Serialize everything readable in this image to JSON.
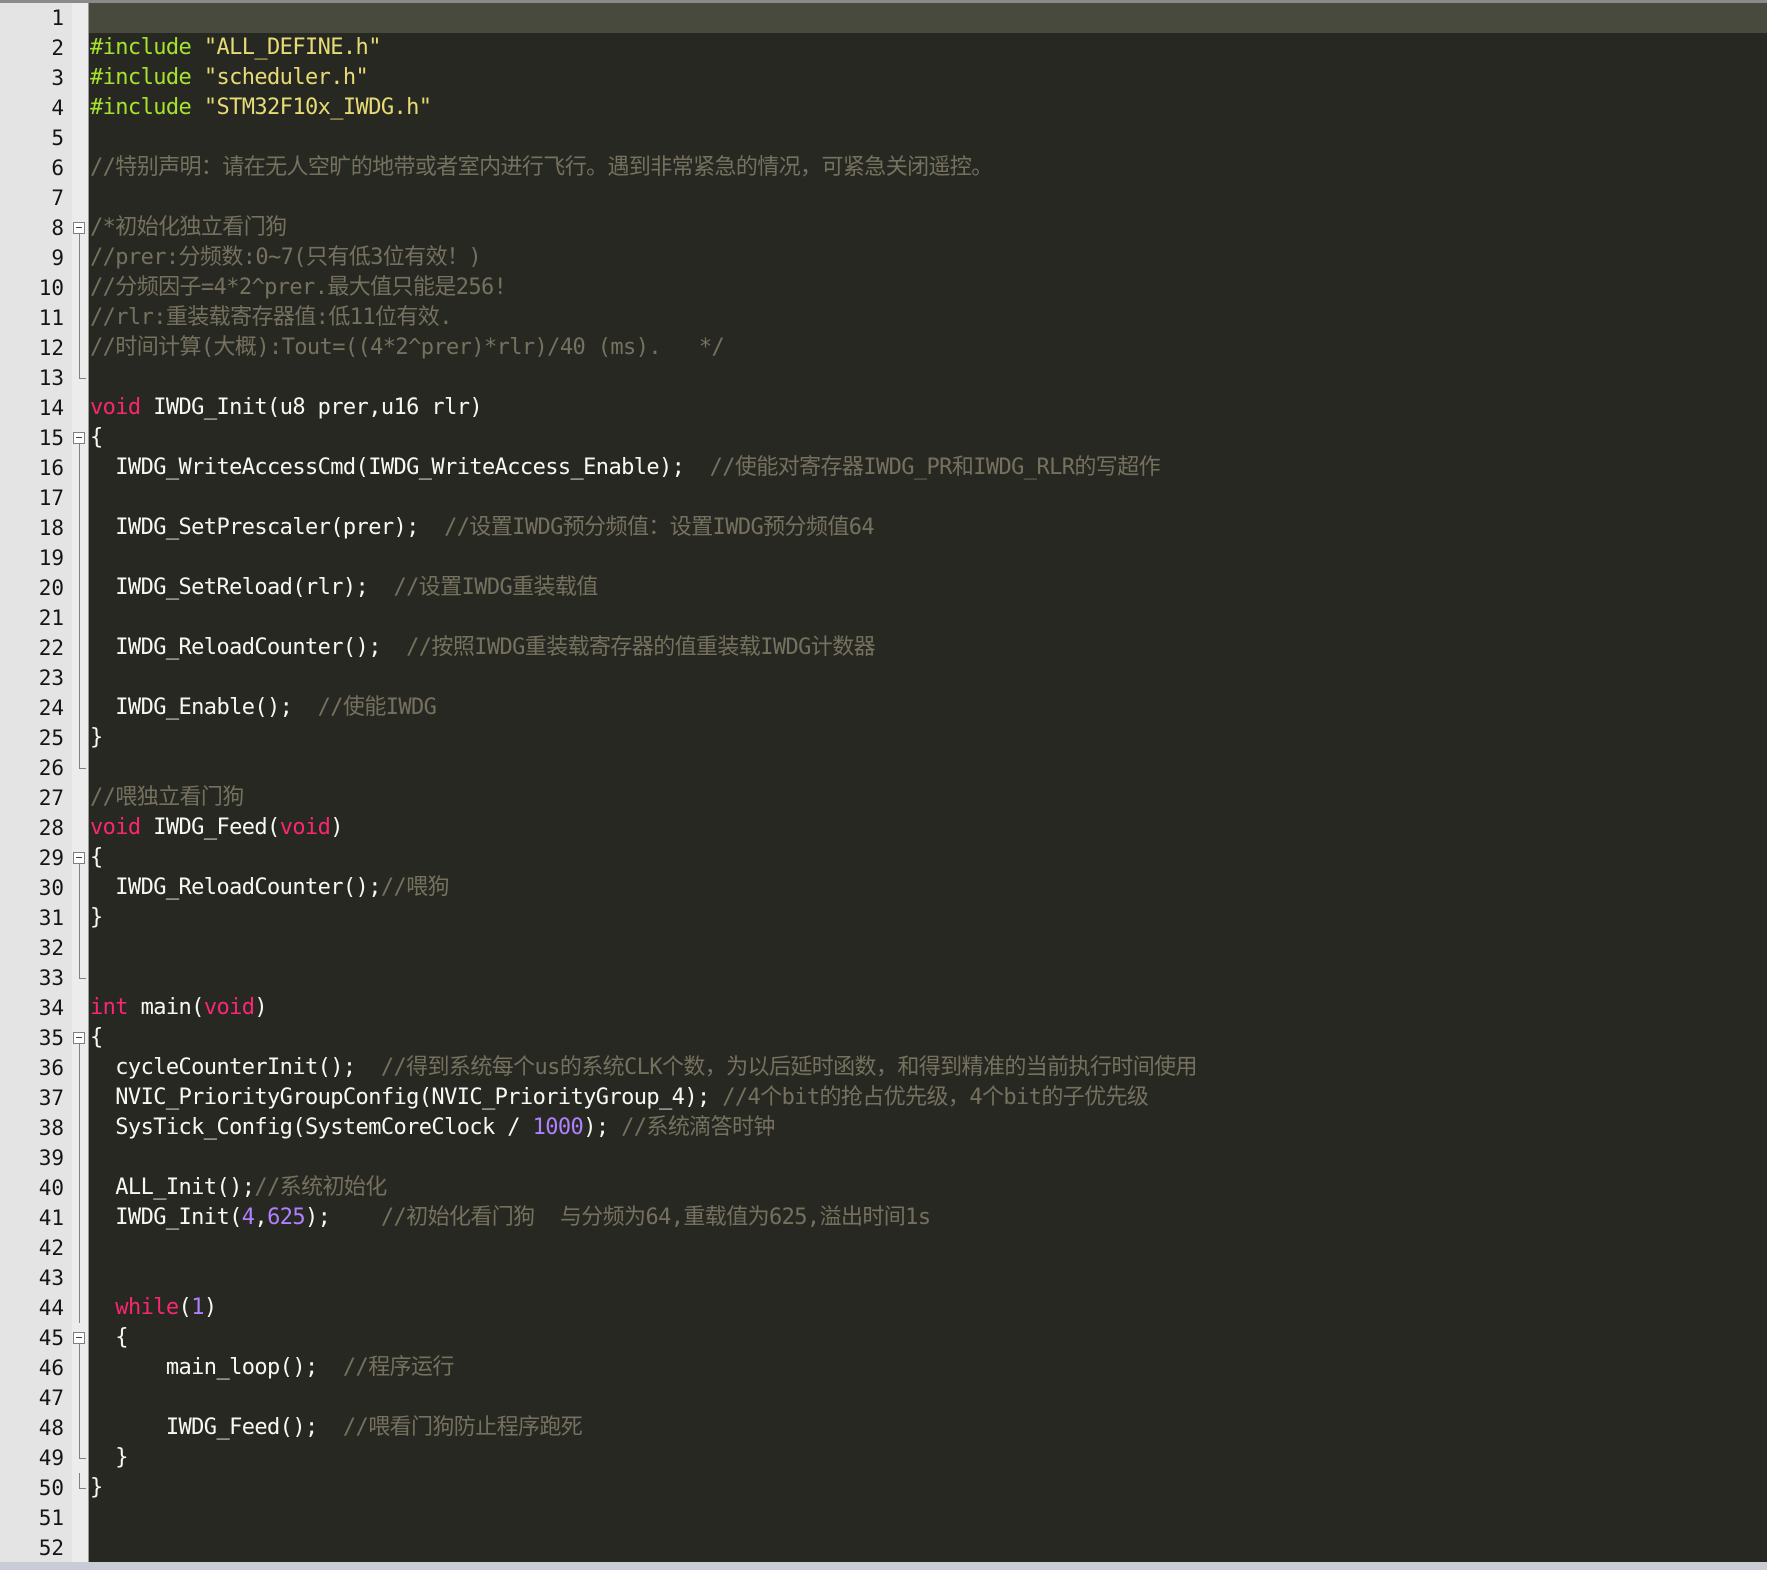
{
  "theme": {
    "background": "#272822",
    "current_line": "#484a3e",
    "gutter_bg": "#e4e4e4",
    "line_number_color": "#141414",
    "token_colors": {
      "pre": "#a6e22e",
      "str": "#e6db74",
      "cmt": "#75715e",
      "kw": "#f92672",
      "num": "#ae81ff",
      "pl": "#f8f8f2"
    }
  },
  "editor": {
    "lines": [
      {
        "n": "1",
        "fold": "",
        "tokens": []
      },
      {
        "n": "2",
        "fold": "",
        "tokens": [
          {
            "t": "pre",
            "v": "#include "
          },
          {
            "t": "str",
            "v": "\"ALL_DEFINE.h\""
          }
        ]
      },
      {
        "n": "3",
        "fold": "",
        "tokens": [
          {
            "t": "pre",
            "v": "#include "
          },
          {
            "t": "str",
            "v": "\"scheduler.h\""
          }
        ]
      },
      {
        "n": "4",
        "fold": "",
        "tokens": [
          {
            "t": "pre",
            "v": "#include "
          },
          {
            "t": "str",
            "v": "\"STM32F10x_IWDG.h\""
          }
        ]
      },
      {
        "n": "5",
        "fold": "",
        "tokens": []
      },
      {
        "n": "6",
        "fold": "",
        "tokens": [
          {
            "t": "cmt",
            "v": "//特别声明：请在无人空旷的地带或者室内进行飞行。遇到非常紧急的情况，可紧急关闭遥控。"
          }
        ]
      },
      {
        "n": "7",
        "fold": "",
        "tokens": []
      },
      {
        "n": "8",
        "fold": "start",
        "tokens": [
          {
            "t": "cmt",
            "v": "/*初始化独立看门狗"
          }
        ]
      },
      {
        "n": "9",
        "fold": "line",
        "tokens": [
          {
            "t": "cmt",
            "v": "//prer:分频数:0~7(只有低3位有效！)"
          }
        ]
      },
      {
        "n": "10",
        "fold": "line",
        "tokens": [
          {
            "t": "cmt",
            "v": "//分频因子=4*2^prer.最大值只能是256!"
          }
        ]
      },
      {
        "n": "11",
        "fold": "line",
        "tokens": [
          {
            "t": "cmt",
            "v": "//rlr:重装载寄存器值:低11位有效."
          }
        ]
      },
      {
        "n": "12",
        "fold": "line",
        "tokens": [
          {
            "t": "cmt",
            "v": "//时间计算(大概):Tout=((4*2^prer)*rlr)/40 (ms).   */"
          }
        ]
      },
      {
        "n": "13",
        "fold": "end",
        "tokens": []
      },
      {
        "n": "14",
        "fold": "",
        "tokens": [
          {
            "t": "kw",
            "v": "void"
          },
          {
            "t": "pl",
            "v": " IWDG_Init(u8 prer,u16 rlr)"
          }
        ]
      },
      {
        "n": "15",
        "fold": "start",
        "tokens": [
          {
            "t": "pl",
            "v": "{"
          }
        ]
      },
      {
        "n": "16",
        "fold": "line",
        "tokens": [
          {
            "t": "pl",
            "v": "  IWDG_WriteAccessCmd(IWDG_WriteAccess_Enable);  "
          },
          {
            "t": "cmt",
            "v": "//使能对寄存器IWDG_PR和IWDG_RLR的写超作"
          }
        ]
      },
      {
        "n": "17",
        "fold": "line",
        "tokens": []
      },
      {
        "n": "18",
        "fold": "line",
        "tokens": [
          {
            "t": "pl",
            "v": "  IWDG_SetPrescaler(prer);  "
          },
          {
            "t": "cmt",
            "v": "//设置IWDG预分频值：设置IWDG预分频值64"
          }
        ]
      },
      {
        "n": "19",
        "fold": "line",
        "tokens": []
      },
      {
        "n": "20",
        "fold": "line",
        "tokens": [
          {
            "t": "pl",
            "v": "  IWDG_SetReload(rlr);  "
          },
          {
            "t": "cmt",
            "v": "//设置IWDG重装载值"
          }
        ]
      },
      {
        "n": "21",
        "fold": "line",
        "tokens": []
      },
      {
        "n": "22",
        "fold": "line",
        "tokens": [
          {
            "t": "pl",
            "v": "  IWDG_ReloadCounter();  "
          },
          {
            "t": "cmt",
            "v": "//按照IWDG重装载寄存器的值重装载IWDG计数器"
          }
        ]
      },
      {
        "n": "23",
        "fold": "line",
        "tokens": []
      },
      {
        "n": "24",
        "fold": "line",
        "tokens": [
          {
            "t": "pl",
            "v": "  IWDG_Enable();  "
          },
          {
            "t": "cmt",
            "v": "//使能IWDG"
          }
        ]
      },
      {
        "n": "25",
        "fold": "line",
        "tokens": [
          {
            "t": "pl",
            "v": "}"
          }
        ]
      },
      {
        "n": "26",
        "fold": "end",
        "tokens": []
      },
      {
        "n": "27",
        "fold": "",
        "tokens": [
          {
            "t": "cmt",
            "v": "//喂独立看门狗"
          }
        ]
      },
      {
        "n": "28",
        "fold": "",
        "tokens": [
          {
            "t": "kw",
            "v": "void"
          },
          {
            "t": "pl",
            "v": " IWDG_Feed("
          },
          {
            "t": "kw",
            "v": "void"
          },
          {
            "t": "pl",
            "v": ")"
          }
        ]
      },
      {
        "n": "29",
        "fold": "start",
        "tokens": [
          {
            "t": "pl",
            "v": "{"
          }
        ]
      },
      {
        "n": "30",
        "fold": "line",
        "tokens": [
          {
            "t": "pl",
            "v": "  IWDG_ReloadCounter();"
          },
          {
            "t": "cmt",
            "v": "//喂狗"
          }
        ]
      },
      {
        "n": "31",
        "fold": "line",
        "tokens": [
          {
            "t": "pl",
            "v": "}"
          }
        ]
      },
      {
        "n": "32",
        "fold": "line",
        "tokens": []
      },
      {
        "n": "33",
        "fold": "end",
        "tokens": []
      },
      {
        "n": "34",
        "fold": "",
        "tokens": [
          {
            "t": "kw",
            "v": "int"
          },
          {
            "t": "pl",
            "v": " main("
          },
          {
            "t": "kw",
            "v": "void"
          },
          {
            "t": "pl",
            "v": ")"
          }
        ]
      },
      {
        "n": "35",
        "fold": "start",
        "tokens": [
          {
            "t": "pl",
            "v": "{"
          }
        ]
      },
      {
        "n": "36",
        "fold": "line",
        "tokens": [
          {
            "t": "pl",
            "v": "  cycleCounterInit();  "
          },
          {
            "t": "cmt",
            "v": "//得到系统每个us的系统CLK个数，为以后延时函数，和得到精准的当前执行时间使用"
          }
        ]
      },
      {
        "n": "37",
        "fold": "line",
        "tokens": [
          {
            "t": "pl",
            "v": "  NVIC_PriorityGroupConfig(NVIC_PriorityGroup_4); "
          },
          {
            "t": "cmt",
            "v": "//4个bit的抢占优先级，4个bit的子优先级"
          }
        ]
      },
      {
        "n": "38",
        "fold": "line",
        "tokens": [
          {
            "t": "pl",
            "v": "  SysTick_Config(SystemCoreClock / "
          },
          {
            "t": "num",
            "v": "1000"
          },
          {
            "t": "pl",
            "v": "); "
          },
          {
            "t": "cmt",
            "v": "//系统滴答时钟"
          }
        ]
      },
      {
        "n": "39",
        "fold": "line",
        "tokens": []
      },
      {
        "n": "40",
        "fold": "line",
        "tokens": [
          {
            "t": "pl",
            "v": "  ALL_Init();"
          },
          {
            "t": "cmt",
            "v": "//系统初始化"
          }
        ]
      },
      {
        "n": "41",
        "fold": "line",
        "tokens": [
          {
            "t": "pl",
            "v": "  IWDG_Init("
          },
          {
            "t": "num",
            "v": "4"
          },
          {
            "t": "pl",
            "v": ","
          },
          {
            "t": "num",
            "v": "625"
          },
          {
            "t": "pl",
            "v": ");    "
          },
          {
            "t": "cmt",
            "v": "//初始化看门狗  与分频为64,重载值为625,溢出时间1s"
          }
        ]
      },
      {
        "n": "42",
        "fold": "line",
        "tokens": []
      },
      {
        "n": "43",
        "fold": "line",
        "tokens": []
      },
      {
        "n": "44",
        "fold": "line",
        "tokens": [
          {
            "t": "pl",
            "v": "  "
          },
          {
            "t": "kw",
            "v": "while"
          },
          {
            "t": "pl",
            "v": "("
          },
          {
            "t": "num",
            "v": "1"
          },
          {
            "t": "pl",
            "v": ")"
          }
        ]
      },
      {
        "n": "45",
        "fold": "start",
        "tokens": [
          {
            "t": "pl",
            "v": "  {"
          }
        ]
      },
      {
        "n": "46",
        "fold": "line",
        "tokens": [
          {
            "t": "pl",
            "v": "      main_loop();  "
          },
          {
            "t": "cmt",
            "v": "//程序运行"
          }
        ]
      },
      {
        "n": "47",
        "fold": "line",
        "tokens": []
      },
      {
        "n": "48",
        "fold": "line",
        "tokens": [
          {
            "t": "pl",
            "v": "      IWDG_Feed();  "
          },
          {
            "t": "cmt",
            "v": "//喂看门狗防止程序跑死"
          }
        ]
      },
      {
        "n": "49",
        "fold": "end",
        "tokens": [
          {
            "t": "pl",
            "v": "  }"
          }
        ]
      },
      {
        "n": "50",
        "fold": "end",
        "tokens": [
          {
            "t": "pl",
            "v": "}"
          }
        ]
      },
      {
        "n": "51",
        "fold": "",
        "tokens": []
      },
      {
        "n": "52",
        "fold": "",
        "tokens": []
      }
    ]
  }
}
